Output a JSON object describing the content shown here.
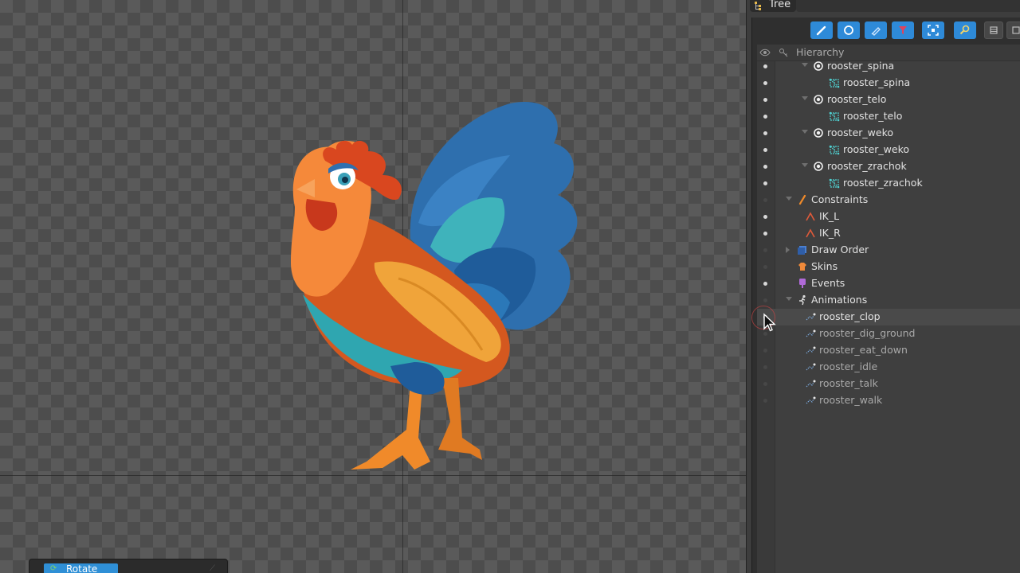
{
  "panel": {
    "title": "Tree"
  },
  "toolbar": {
    "buttons": [
      {
        "name": "bones-filter-button",
        "icon": "bone-icon"
      },
      {
        "name": "slots-filter-button",
        "icon": "circle-icon"
      },
      {
        "name": "attachments-filter-button",
        "icon": "pencil-icon"
      },
      {
        "name": "constraints-filter-button",
        "icon": "funnel-icon"
      },
      {
        "name": "fit-button",
        "icon": "frame-icon"
      },
      {
        "name": "search-button",
        "icon": "magnifier-icon"
      },
      {
        "name": "collapse-button",
        "icon": "stack-icon"
      }
    ]
  },
  "hierarchy": {
    "header": "Hierarchy",
    "rows": [
      {
        "label": "rooster_spina",
        "type": "slot",
        "indent": 2,
        "visible": true
      },
      {
        "label": "rooster_spina",
        "type": "mesh",
        "indent": 3,
        "visible": true
      },
      {
        "label": "rooster_telo",
        "type": "slot",
        "indent": 2,
        "visible": true
      },
      {
        "label": "rooster_telo",
        "type": "mesh",
        "indent": 3,
        "visible": true
      },
      {
        "label": "rooster_weko",
        "type": "slot",
        "indent": 2,
        "visible": true
      },
      {
        "label": "rooster_weko",
        "type": "mesh",
        "indent": 3,
        "visible": true
      },
      {
        "label": "rooster_zrachok",
        "type": "slot",
        "indent": 2,
        "visible": true
      },
      {
        "label": "rooster_zrachok",
        "type": "mesh",
        "indent": 3,
        "visible": true
      },
      {
        "label": "Constraints",
        "type": "constraints",
        "indent": 1,
        "visible": false
      },
      {
        "label": "IK_L",
        "type": "ik",
        "indent": 1.5,
        "visible": true
      },
      {
        "label": "IK_R",
        "type": "ik",
        "indent": 1.5,
        "visible": true
      },
      {
        "label": "Draw Order",
        "type": "draworder",
        "indent": 1,
        "visible": false
      },
      {
        "label": "Skins",
        "type": "skins",
        "indent": 1,
        "visible": false
      },
      {
        "label": "Events",
        "type": "events",
        "indent": 1,
        "visible": true
      },
      {
        "label": "Animations",
        "type": "animations",
        "indent": 1,
        "visible": false
      },
      {
        "label": "rooster_clop",
        "type": "animation",
        "indent": 1.5,
        "visible": true,
        "selected": true
      },
      {
        "label": "rooster_dig_ground",
        "type": "animation",
        "indent": 1.5,
        "visible": false
      },
      {
        "label": "rooster_eat_down",
        "type": "animation",
        "indent": 1.5,
        "visible": false
      },
      {
        "label": "rooster_idle",
        "type": "animation",
        "indent": 1.5,
        "visible": false
      },
      {
        "label": "rooster_talk",
        "type": "animation",
        "indent": 1.5,
        "visible": false
      },
      {
        "label": "rooster_walk",
        "type": "animation",
        "indent": 1.5,
        "visible": false
      }
    ]
  },
  "viewport": {
    "tool": "Rotate"
  },
  "colors": {
    "accent": "#2e8ad8",
    "background": "#3d3d3d"
  }
}
